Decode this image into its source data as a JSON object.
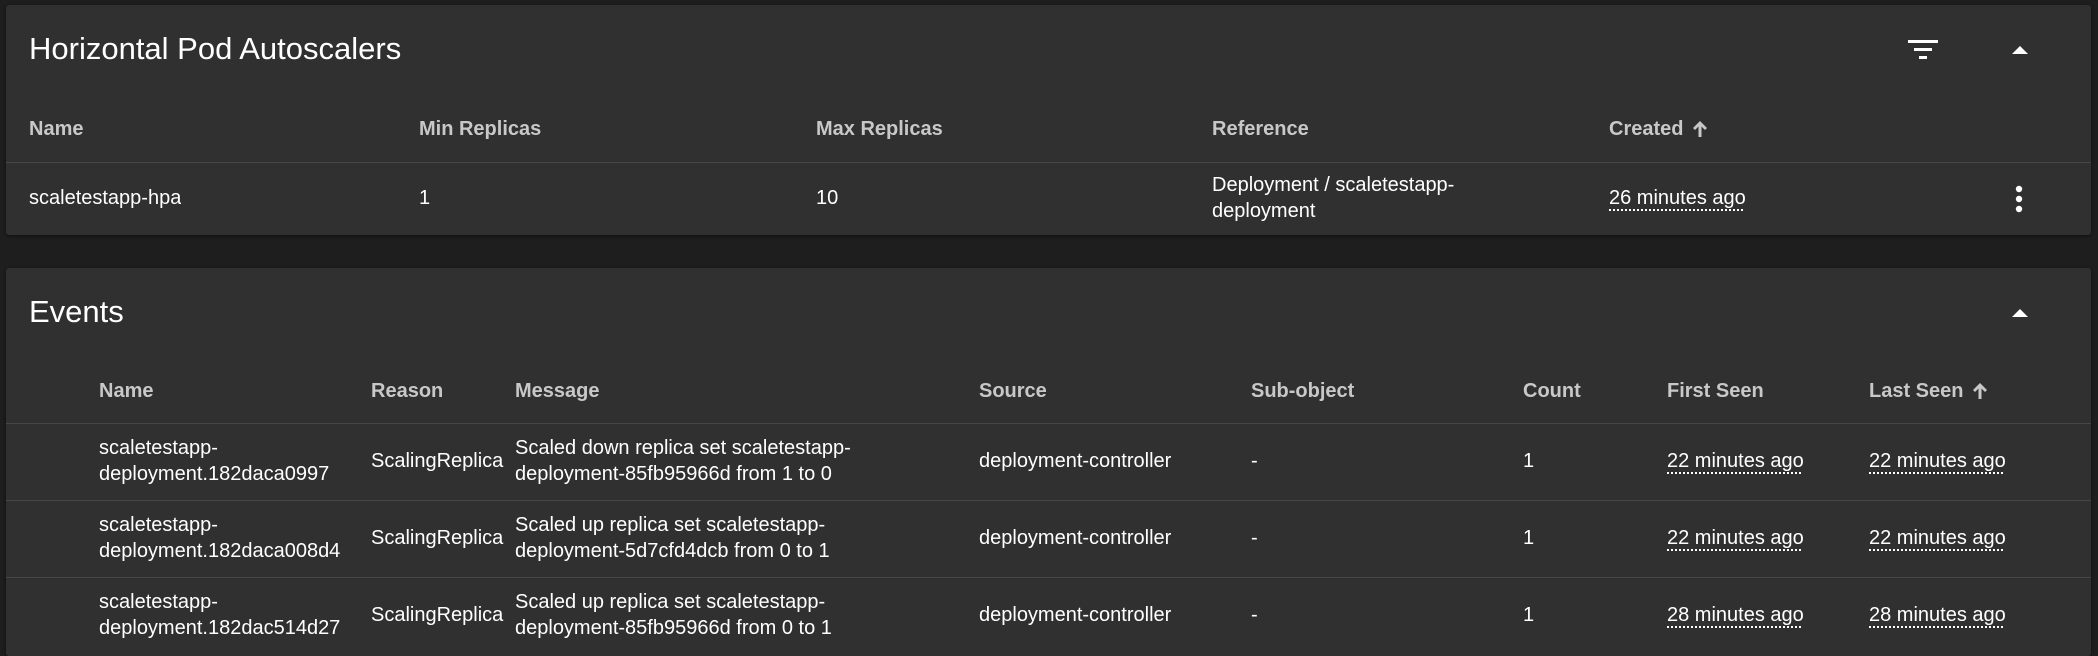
{
  "hpa": {
    "title": "Horizontal Pod Autoscalers",
    "columns": {
      "name": "Name",
      "min_replicas": "Min Replicas",
      "max_replicas": "Max Replicas",
      "reference": "Reference",
      "created": "Created"
    },
    "rows": [
      {
        "name": "scaletestapp-hpa",
        "min_replicas": "1",
        "max_replicas": "10",
        "reference_line1": "Deployment / scaletestapp-",
        "reference_line2": "deployment",
        "created": "26 minutes ago"
      }
    ]
  },
  "events": {
    "title": "Events",
    "columns": {
      "name": "Name",
      "reason": "Reason",
      "message": "Message",
      "source": "Source",
      "sub_object": "Sub-object",
      "count": "Count",
      "first_seen": "First Seen",
      "last_seen": "Last Seen"
    },
    "rows": [
      {
        "name_line1": "scaletestapp-",
        "name_line2": "deployment.182daca0997",
        "reason": "ScalingReplica",
        "message_line1": "Scaled down replica set scaletestapp-",
        "message_line2": "deployment-85fb95966d from 1 to 0",
        "source": "deployment-controller",
        "sub_object": "-",
        "count": "1",
        "first_seen": "22 minutes ago",
        "last_seen": "22 minutes ago"
      },
      {
        "name_line1": "scaletestapp-",
        "name_line2": "deployment.182daca008d4",
        "reason": "ScalingReplica",
        "message_line1": "Scaled up replica set scaletestapp-",
        "message_line2": "deployment-5d7cfd4dcb from 0 to 1",
        "source": "deployment-controller",
        "sub_object": "-",
        "count": "1",
        "first_seen": "22 minutes ago",
        "last_seen": "22 minutes ago"
      },
      {
        "name_line1": "scaletestapp-",
        "name_line2": "deployment.182dac514d27",
        "reason": "ScalingReplica",
        "message_line1": "Scaled up replica set scaletestapp-",
        "message_line2": "deployment-85fb95966d from 0 to 1",
        "source": "deployment-controller",
        "sub_object": "-",
        "count": "1",
        "first_seen": "28 minutes ago",
        "last_seen": "28 minutes ago"
      }
    ]
  },
  "icons": {
    "filter": "filter-icon",
    "collapse": "chevron-up-icon",
    "more": "more-vert-icon",
    "sort": "arrow-up-icon"
  },
  "colors": {
    "background": "#1e1e1e",
    "card": "#303030",
    "divider": "#474747",
    "header_text": "#c8c8c8",
    "text": "#ffffff"
  }
}
